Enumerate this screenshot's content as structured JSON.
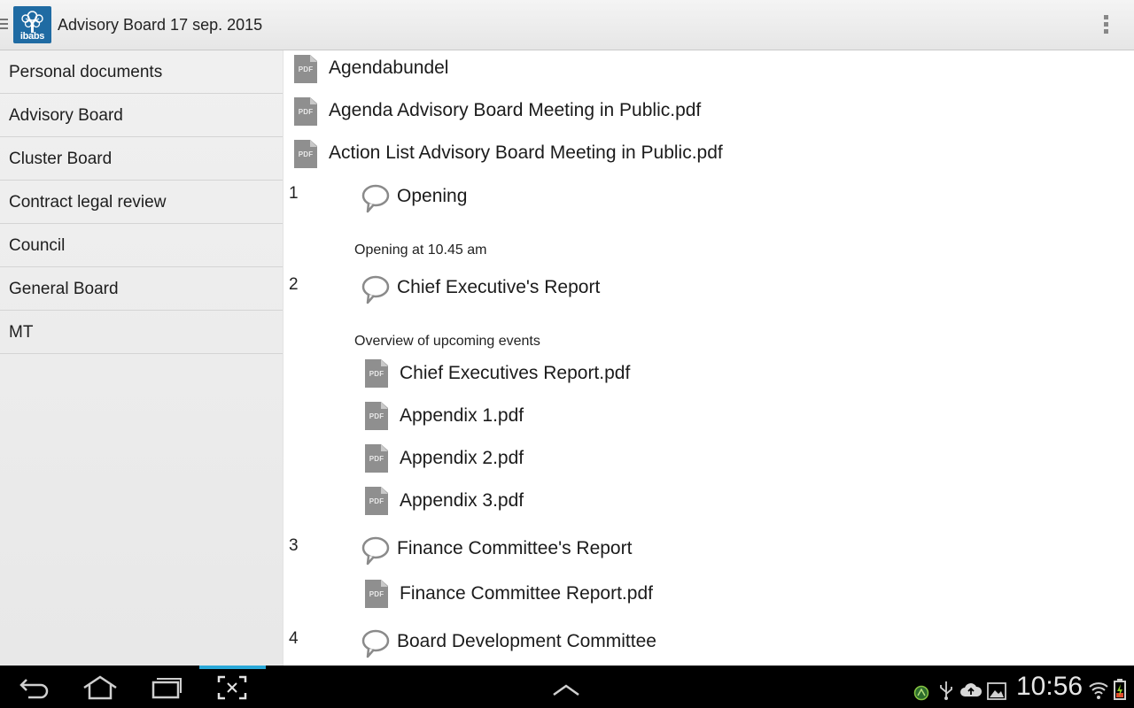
{
  "app": {
    "logo_text": "ibabs",
    "title": "Advisory Board 17 sep. 2015"
  },
  "sidebar": {
    "items": [
      {
        "label": "Personal documents"
      },
      {
        "label": "Advisory Board"
      },
      {
        "label": "Cluster Board"
      },
      {
        "label": "Contract legal review"
      },
      {
        "label": "Council"
      },
      {
        "label": "General Board"
      },
      {
        "label": "MT"
      }
    ]
  },
  "documents": {
    "top": [
      {
        "name": "Agendabundel",
        "icon": "pdf-icon"
      },
      {
        "name": "Agenda Advisory Board Meeting in Public.pdf",
        "icon": "pdf-icon"
      },
      {
        "name": "Action List Advisory Board Meeting in Public.pdf",
        "icon": "pdf-icon"
      }
    ]
  },
  "agenda": [
    {
      "number": "1",
      "title": "Opening",
      "description": "Opening at 10.45 am",
      "documents": []
    },
    {
      "number": "2",
      "title": "Chief Executive's Report",
      "description": "Overview of upcoming events",
      "documents": [
        "Chief Executives Report.pdf",
        "Appendix 1.pdf",
        "Appendix 2.pdf",
        "Appendix 3.pdf"
      ]
    },
    {
      "number": "3",
      "title": "Finance Committee's Report",
      "description": "",
      "documents": [
        "Finance Committee Report.pdf"
      ]
    },
    {
      "number": "4",
      "title": "Board Development Committee",
      "description": "",
      "documents": []
    }
  ],
  "pdf_label": "PDF",
  "system_bar": {
    "time": "10:56",
    "icons": [
      "back-icon",
      "home-icon",
      "recent-apps-icon",
      "screenshot-icon",
      "expand-up-icon",
      "android-icon",
      "usb-icon",
      "cloud-upload-icon",
      "image-icon",
      "wifi-icon",
      "battery-charging-icon"
    ]
  },
  "colors": {
    "logo": "#1f6ba3",
    "accent": "#2aa8d8",
    "pdf_icon": "#8f8f8f"
  }
}
